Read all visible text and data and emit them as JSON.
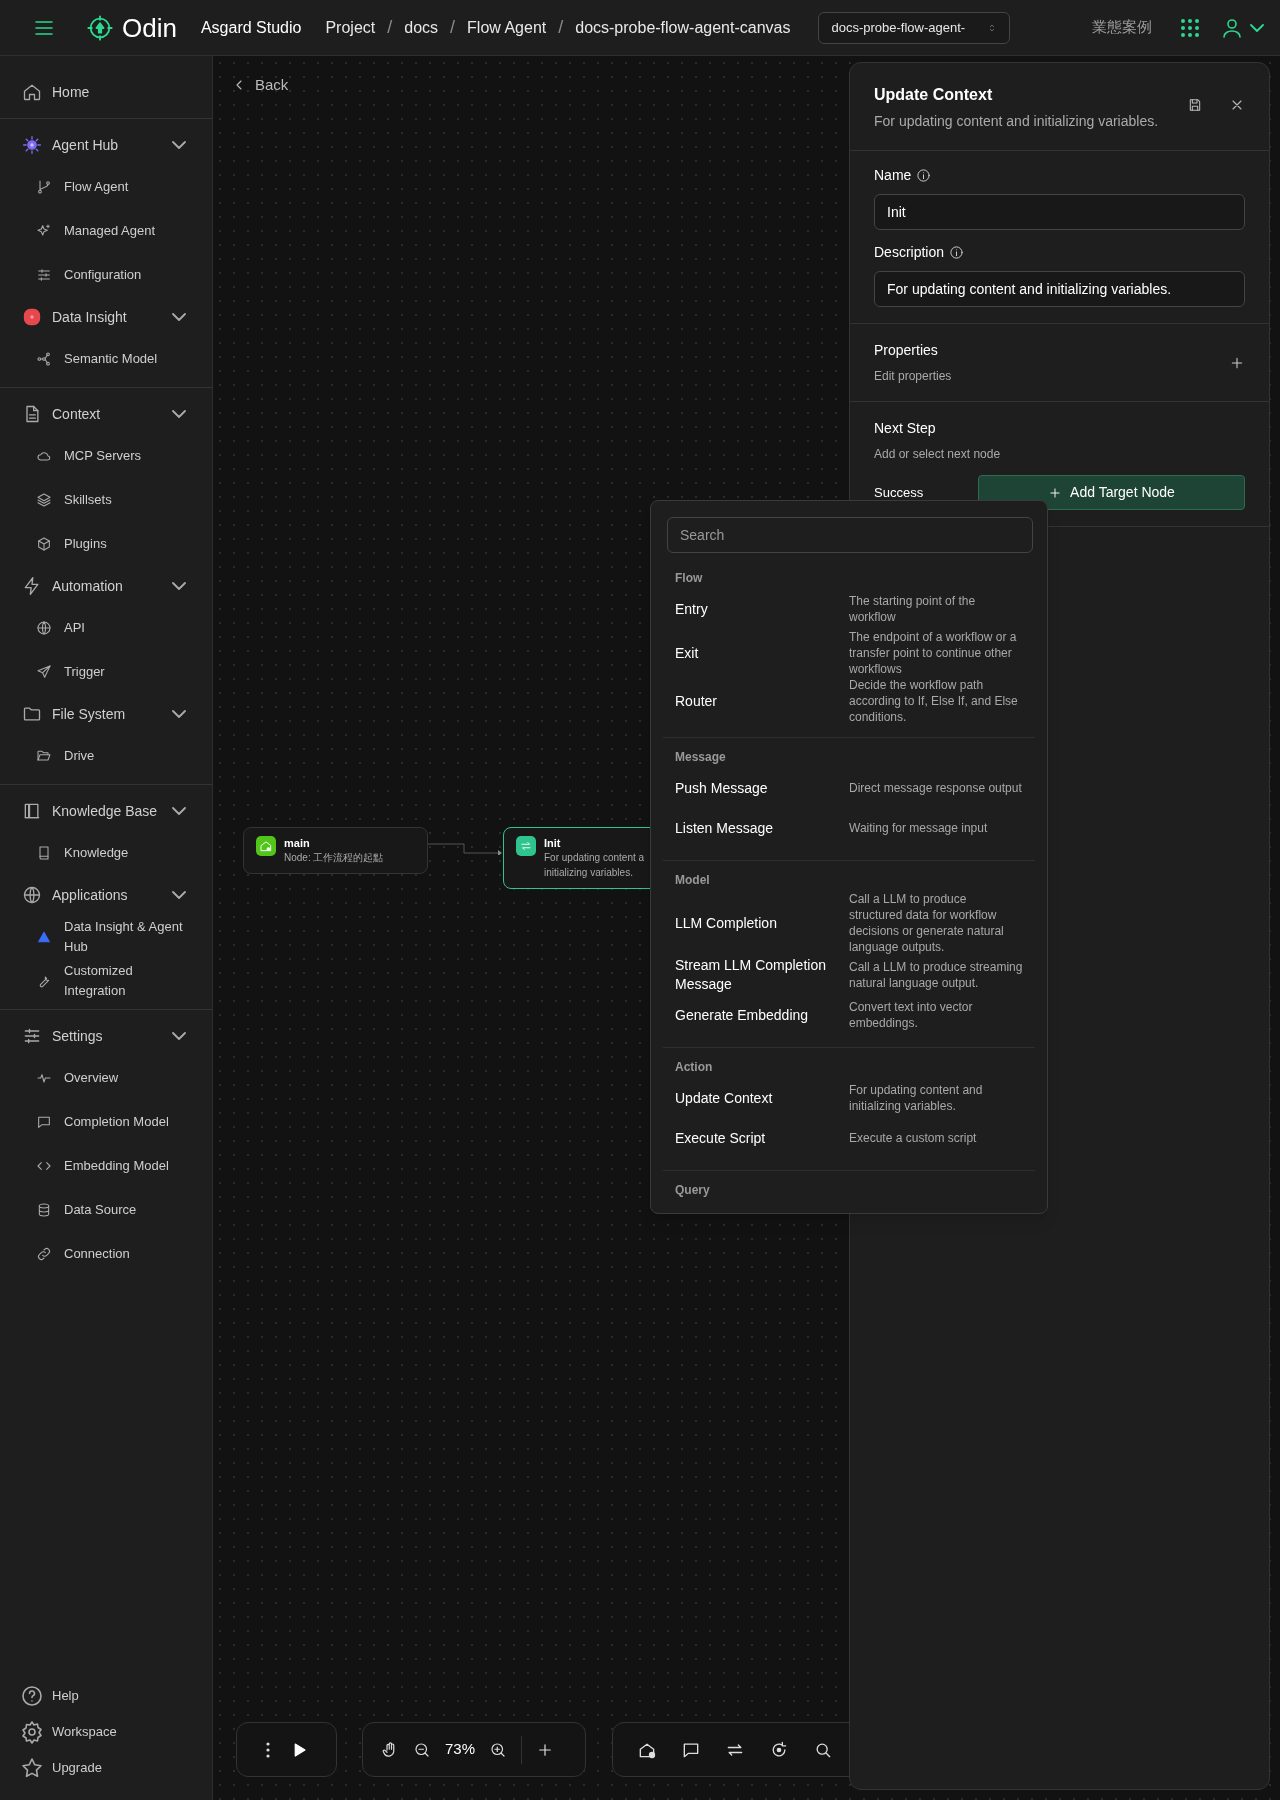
{
  "header": {
    "app_name": "Odin",
    "workspace": "Asgard Studio",
    "breadcrumbs": [
      {
        "label": "Project"
      },
      {
        "separator": "/",
        "label": "docs"
      },
      {
        "separator": "/",
        "label": "Flow Agent"
      },
      {
        "separator": "/",
        "label": "docs-probe-flow-agent-canvas"
      }
    ],
    "select": {
      "value": "docs-probe-flow-agent-"
    },
    "link": "業態案例"
  },
  "sidebar": {
    "sections": [
      {
        "items": [
          {
            "label": "Home"
          }
        ]
      },
      {
        "items": [
          {
            "label": "Agent Hub",
            "expanded": true,
            "children": [
              {
                "label": "Flow Agent"
              },
              {
                "label": "Managed Agent"
              },
              {
                "label": "Configuration"
              }
            ]
          },
          {
            "label": "Data Insight",
            "expanded": true,
            "children": [
              {
                "label": "Semantic Model"
              }
            ]
          }
        ]
      },
      {
        "items": [
          {
            "label": "Context",
            "expanded": true,
            "children": [
              {
                "label": "MCP Servers"
              },
              {
                "label": "Skillsets"
              },
              {
                "label": "Plugins"
              }
            ]
          },
          {
            "label": "Automation",
            "expanded": true,
            "children": [
              {
                "label": "API"
              },
              {
                "label": "Trigger"
              }
            ]
          },
          {
            "label": "File System",
            "expanded": true,
            "children": [
              {
                "label": "Drive"
              }
            ]
          }
        ]
      },
      {
        "items": [
          {
            "label": "Knowledge Base",
            "expanded": true,
            "children": [
              {
                "label": "Knowledge"
              }
            ]
          },
          {
            "label": "Applications",
            "expanded": true,
            "children": [
              {
                "label": "Data Insight & Agent Hub"
              },
              {
                "label": "Customized Integration"
              }
            ]
          }
        ]
      },
      {
        "items": [
          {
            "label": "Settings",
            "expanded": true,
            "children": [
              {
                "label": "Overview"
              },
              {
                "label": "Completion Model"
              },
              {
                "label": "Embedding Model"
              },
              {
                "label": "Data Source"
              },
              {
                "label": "Connection"
              }
            ]
          }
        ]
      }
    ],
    "footer": [
      "Help",
      "Workspace",
      "Upgrade"
    ]
  },
  "canvas": {
    "back": "Back",
    "nodes": [
      {
        "kind": "entry",
        "title": "main",
        "lines": [
          "Node: 工作流程的起點"
        ],
        "selected": false
      },
      {
        "kind": "update",
        "title": "Init",
        "lines": [
          "For updating content a",
          "initializing variables."
        ],
        "selected": true
      }
    ],
    "zoom": "73%"
  },
  "panel": {
    "title": "Update Context",
    "subtitle": "For updating content and initializing variables.",
    "fields": [
      {
        "label": "Name",
        "value": "Init"
      },
      {
        "label": "Description",
        "value": "For updating content and initializing variables."
      }
    ],
    "properties": {
      "title": "Properties",
      "subtitle": "Edit properties"
    },
    "next_step": {
      "title": "Next Step",
      "subtitle": "Add or select next node",
      "branches": [
        {
          "label": "Success",
          "button": "Add Target Node"
        }
      ]
    }
  },
  "node_menu": {
    "search_placeholder": "Search",
    "groups": [
      {
        "title": "Flow",
        "items": [
          {
            "name": "Entry",
            "description": "The starting point of the workflow"
          },
          {
            "name": "Exit",
            "description": "The endpoint of a workflow or a transfer point to continue other workflows"
          },
          {
            "name": "Router",
            "description": "Decide the workflow path according to If, Else If, and Else conditions."
          }
        ]
      },
      {
        "title": "Message",
        "items": [
          {
            "name": "Push Message",
            "description": "Direct message response output"
          },
          {
            "name": "Listen Message",
            "description": "Waiting for message input"
          }
        ]
      },
      {
        "title": "Model",
        "items": [
          {
            "name": "LLM Completion",
            "description": "Call a LLM to produce structured data for workflow decisions or generate natural language outputs."
          },
          {
            "name": "Stream LLM Completion Message",
            "description": "Call a LLM to produce streaming natural language output."
          },
          {
            "name": "Generate Embedding",
            "description": "Convert text into vector embeddings."
          }
        ]
      },
      {
        "title": "Action",
        "items": [
          {
            "name": "Update Context",
            "description": "For updating content and initializing variables."
          },
          {
            "name": "Execute Script",
            "description": "Execute a custom script"
          }
        ]
      },
      {
        "title": "Query"
      }
    ]
  }
}
